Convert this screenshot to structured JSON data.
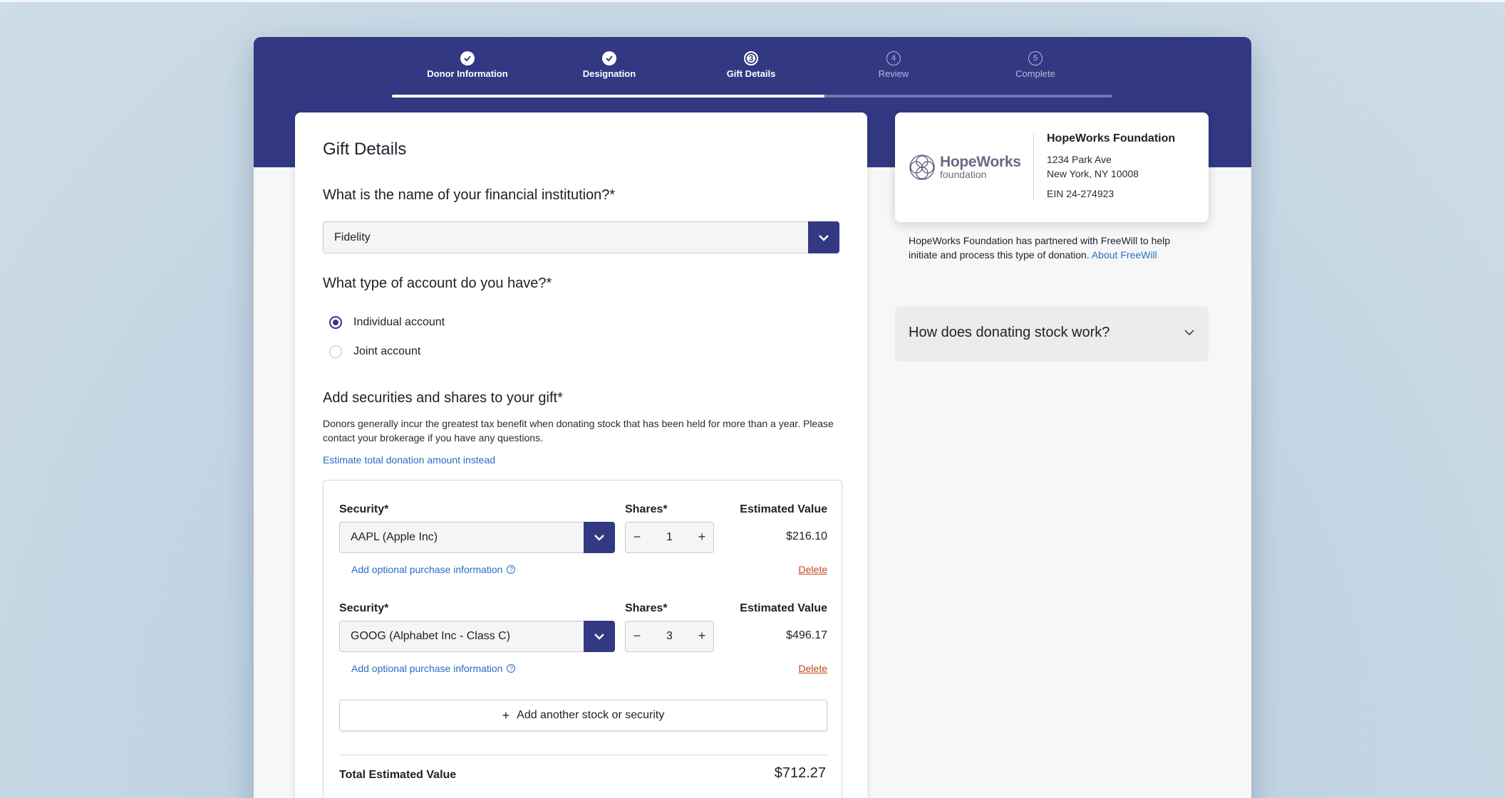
{
  "stepper": {
    "steps": [
      {
        "label": "Donor Information",
        "state": "done",
        "marker": ""
      },
      {
        "label": "Designation",
        "state": "done",
        "marker": ""
      },
      {
        "label": "Gift Details",
        "state": "current",
        "marker": "3"
      },
      {
        "label": "Review",
        "state": "future",
        "marker": "4"
      },
      {
        "label": "Complete",
        "state": "future",
        "marker": "5"
      }
    ],
    "progress_fraction": 0.6
  },
  "form": {
    "title": "Gift Details",
    "institution_question": "What is the name of your financial institution?*",
    "institution_value": "Fidelity",
    "account_question": "What type of account do you have?*",
    "account_options": [
      {
        "label": "Individual account",
        "selected": true
      },
      {
        "label": "Joint account",
        "selected": false
      }
    ],
    "securities_question": "Add securities and shares to your gift*",
    "securities_help": "Donors generally incur the greatest tax benefit when donating stock that has been held for more than a year. Please contact your brokerage if you have any questions.",
    "estimate_link": "Estimate total donation amount instead",
    "security_label": "Security*",
    "shares_label": "Shares*",
    "estimated_value_label": "Estimated Value",
    "securities": [
      {
        "name": "AAPL (Apple Inc)",
        "shares": "1",
        "value": "$216.10"
      },
      {
        "name": "GOOG (Alphabet Inc - Class C)",
        "shares": "3",
        "value": "$496.17"
      }
    ],
    "purchase_info_link": "Add optional purchase information",
    "delete_label": "Delete",
    "add_security_label": "Add another stock or security",
    "total_label": "Total Estimated Value",
    "total_value": "$712.27"
  },
  "org": {
    "logo_title": "HopeWorks",
    "logo_subtitle": "foundation",
    "name": "HopeWorks Foundation",
    "address_line1": "1234 Park Ave",
    "address_line2": "New York, NY 10008",
    "ein": "EIN 24-274923",
    "partner_text": "HopeWorks Foundation has partnered with FreeWill to help initiate and process this type of donation.",
    "about_link": "About FreeWill"
  },
  "faq": {
    "question": "How does donating stock work?"
  },
  "colors": {
    "brand_navy": "#323882",
    "link_blue": "#2b6cc4",
    "delete_orange": "#c5451b"
  },
  "icons": {
    "done_step": "checkmark-icon",
    "select": "chevron-down-icon",
    "info": "info-icon",
    "add": "plus-icon"
  }
}
